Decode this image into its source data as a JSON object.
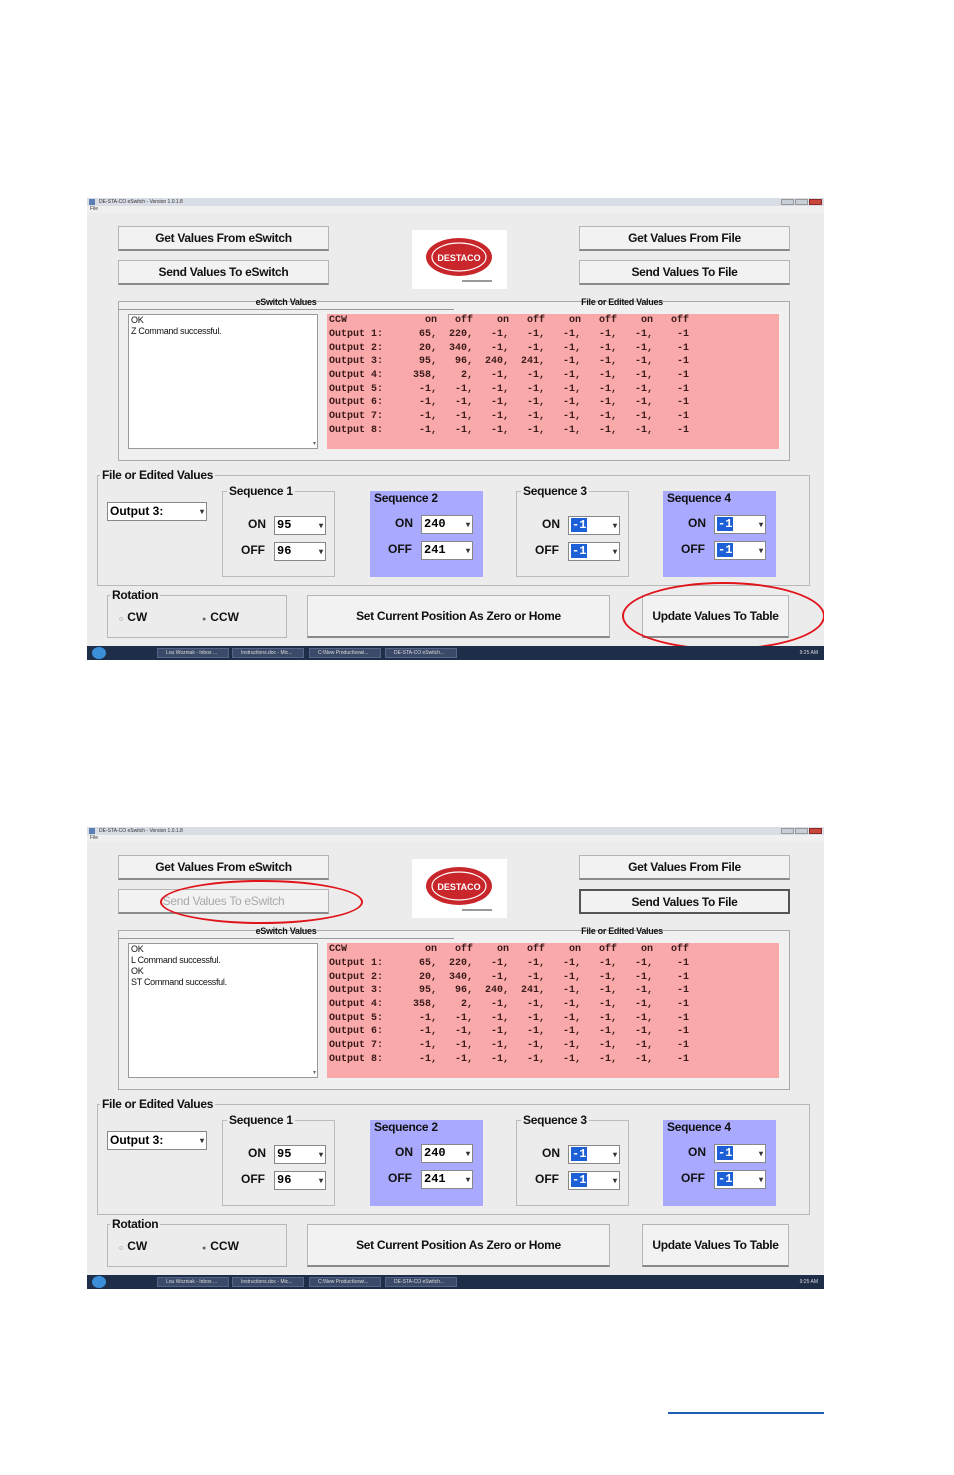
{
  "screenshots": [
    {
      "window_title": "DE-STA-CO eSwitch - Version 1.0.1.8",
      "menu_file": "File",
      "buttons": {
        "get_from_eswitch": "Get Values From eSwitch",
        "send_to_eswitch": "Send Values To eSwitch",
        "get_from_file": "Get Values From File",
        "send_to_file": "Send Values To File",
        "set_zero": "Set Current Position As Zero or Home",
        "update_table": "Update Values To Table"
      },
      "logo_text": "DESTACO",
      "tabs": {
        "eswitch": "eSwitch Values",
        "file": "File or Edited Values"
      },
      "log_lines": [
        "OK",
        "Z Command successful."
      ],
      "table": {
        "header": [
          "CCW",
          "on",
          "off",
          "on",
          "off",
          "on",
          "off",
          "on",
          "off"
        ],
        "rows": [
          [
            "Output 1:",
            "65,",
            "220,",
            "-1,",
            "-1,",
            "-1,",
            "-1,",
            "-1,",
            "-1"
          ],
          [
            "Output 2:",
            "20,",
            "340,",
            "-1,",
            "-1,",
            "-1,",
            "-1,",
            "-1,",
            "-1"
          ],
          [
            "Output 3:",
            "95,",
            "96,",
            "240,",
            "241,",
            "-1,",
            "-1,",
            "-1,",
            "-1"
          ],
          [
            "Output 4:",
            "358,",
            "2,",
            "-1,",
            "-1,",
            "-1,",
            "-1,",
            "-1,",
            "-1"
          ],
          [
            "Output 5:",
            "-1,",
            "-1,",
            "-1,",
            "-1,",
            "-1,",
            "-1,",
            "-1,",
            "-1"
          ],
          [
            "Output 6:",
            "-1,",
            "-1,",
            "-1,",
            "-1,",
            "-1,",
            "-1,",
            "-1,",
            "-1"
          ],
          [
            "Output 7:",
            "-1,",
            "-1,",
            "-1,",
            "-1,",
            "-1,",
            "-1,",
            "-1,",
            "-1"
          ],
          [
            "Output 8:",
            "-1,",
            "-1,",
            "-1,",
            "-1,",
            "-1,",
            "-1,",
            "-1,",
            "-1"
          ]
        ]
      },
      "edit_group_title": "File or Edited Values",
      "output_select": "Output 3:",
      "sequences": [
        {
          "title": "Sequence 1",
          "on": "95",
          "off": "96"
        },
        {
          "title": "Sequence 2",
          "on": "240",
          "off": "241"
        },
        {
          "title": "Sequence 3",
          "on": "-1",
          "off": "-1"
        },
        {
          "title": "Sequence 4",
          "on": "-1",
          "off": "-1"
        }
      ],
      "labels": {
        "on": "ON",
        "off": "OFF"
      },
      "rotation": {
        "title": "Rotation",
        "cw": "CW",
        "ccw": "CCW"
      },
      "taskbar": {
        "items": [
          "Lou Wozniak - Inbox ...",
          "Instructions.doc - Mic...",
          "C:\\New Product\\eswi...",
          "DE-STA-CO eSwitch..."
        ],
        "clock": "9:25 AM"
      }
    },
    {
      "window_title": "DE-STA-CO eSwitch - Version 1.0.1.8",
      "menu_file": "File",
      "buttons": {
        "get_from_eswitch": "Get Values From eSwitch",
        "send_to_eswitch": "Send Values To eSwitch",
        "get_from_file": "Get Values From File",
        "send_to_file": "Send Values To File",
        "set_zero": "Set Current Position As Zero or Home",
        "update_table": "Update Values To Table"
      },
      "logo_text": "DESTACO",
      "tabs": {
        "eswitch": "eSwitch Values",
        "file": "File or Edited Values"
      },
      "log_lines": [
        "OK",
        "L  Command successful.",
        "OK",
        "ST Command successful."
      ],
      "table": {
        "header": [
          "CCW",
          "on",
          "off",
          "on",
          "off",
          "on",
          "off",
          "on",
          "off"
        ],
        "rows": [
          [
            "Output 1:",
            "65,",
            "220,",
            "-1,",
            "-1,",
            "-1,",
            "-1,",
            "-1,",
            "-1"
          ],
          [
            "Output 2:",
            "20,",
            "340,",
            "-1,",
            "-1,",
            "-1,",
            "-1,",
            "-1,",
            "-1"
          ],
          [
            "Output 3:",
            "95,",
            "96,",
            "240,",
            "241,",
            "-1,",
            "-1,",
            "-1,",
            "-1"
          ],
          [
            "Output 4:",
            "358,",
            "2,",
            "-1,",
            "-1,",
            "-1,",
            "-1,",
            "-1,",
            "-1"
          ],
          [
            "Output 5:",
            "-1,",
            "-1,",
            "-1,",
            "-1,",
            "-1,",
            "-1,",
            "-1,",
            "-1"
          ],
          [
            "Output 6:",
            "-1,",
            "-1,",
            "-1,",
            "-1,",
            "-1,",
            "-1,",
            "-1,",
            "-1"
          ],
          [
            "Output 7:",
            "-1,",
            "-1,",
            "-1,",
            "-1,",
            "-1,",
            "-1,",
            "-1,",
            "-1"
          ],
          [
            "Output 8:",
            "-1,",
            "-1,",
            "-1,",
            "-1,",
            "-1,",
            "-1,",
            "-1,",
            "-1"
          ]
        ]
      },
      "edit_group_title": "File or Edited Values",
      "output_select": "Output 3:",
      "sequences": [
        {
          "title": "Sequence 1",
          "on": "95",
          "off": "96"
        },
        {
          "title": "Sequence 2",
          "on": "240",
          "off": "241"
        },
        {
          "title": "Sequence 3",
          "on": "-1",
          "off": "-1"
        },
        {
          "title": "Sequence 4",
          "on": "-1",
          "off": "-1"
        }
      ],
      "labels": {
        "on": "ON",
        "off": "OFF"
      },
      "rotation": {
        "title": "Rotation",
        "cw": "CW",
        "ccw": "CCW"
      },
      "taskbar": {
        "items": [
          "Lou Wozniak - Inbox ...",
          "Instructions.doc - Mic...",
          "C:\\New Product\\eswi...",
          "DE-STA-CO eSwitch..."
        ],
        "clock": "9:25 AM"
      }
    }
  ]
}
